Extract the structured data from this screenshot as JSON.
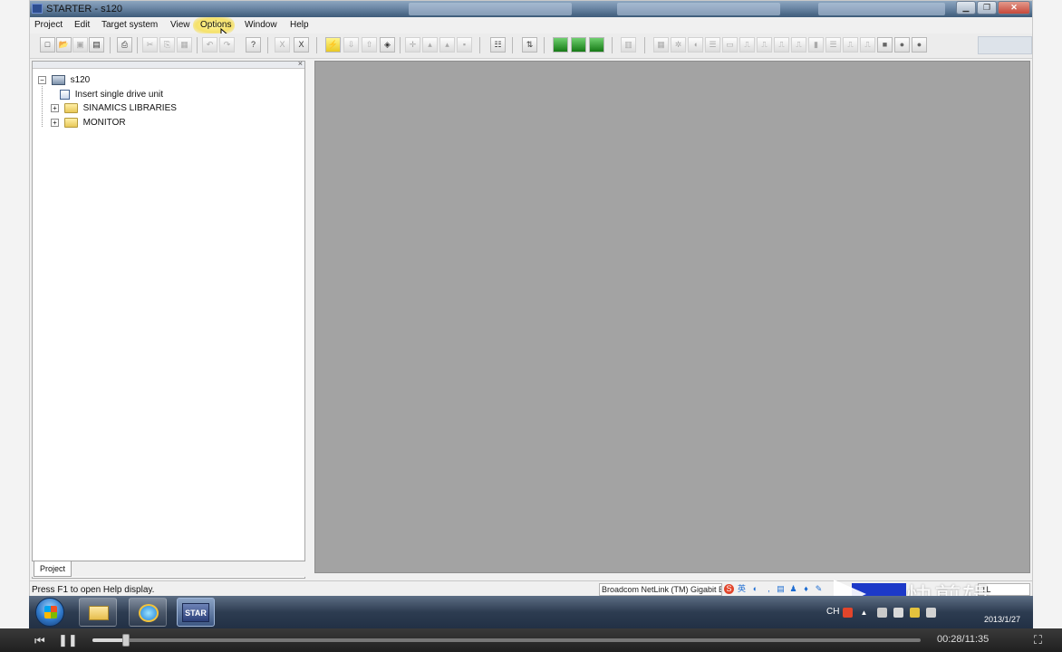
{
  "window": {
    "title": "STARTER - s120",
    "buttons": [
      "minimize",
      "maximize",
      "close"
    ]
  },
  "menubar": {
    "items": [
      "Project",
      "Edit",
      "Target system",
      "View",
      "Options",
      "Window",
      "Help"
    ],
    "highlighted": "Options"
  },
  "toolbar": {
    "groups": [
      [
        "new-icon",
        "open-icon",
        "save-icon",
        "save-compile-icon"
      ],
      [
        "print-icon"
      ],
      [
        "cut-icon",
        "copy-icon",
        "paste-icon"
      ],
      [
        "undo-icon",
        "redo-icon"
      ],
      [
        "help-pointer-icon"
      ],
      [
        "x-icon",
        "x-sub-icon"
      ],
      [
        "connect-icon",
        "download-icon",
        "upload-icon",
        "online-icon"
      ],
      [
        "move-icon",
        "load-device-icon",
        "load-cpu-icon",
        "load-ram-icon"
      ],
      [
        "device-table-icon"
      ],
      [
        "adjust-icon"
      ],
      [
        "panel-a-icon",
        "panel-b-icon",
        "panel-c-icon"
      ],
      [
        "print-preview-icon"
      ],
      [
        "tool1-icon",
        "tool2-icon",
        "tool3-icon",
        "tool4-icon",
        "tool5-icon",
        "tool6-icon",
        "tool7-icon",
        "tool8-icon",
        "tool9-icon",
        "tool10-icon",
        "tool11-icon",
        "tool12-icon",
        "tool13-icon",
        "stop-icon",
        "record-icon",
        "stop2-icon"
      ]
    ]
  },
  "project_tree": {
    "root": "s120",
    "items": [
      {
        "label": "Insert single drive unit",
        "icon": "insert-drive-icon",
        "expandable": false
      },
      {
        "label": "SINAMICS LIBRARIES",
        "icon": "folder-icon",
        "expandable": true
      },
      {
        "label": "MONITOR",
        "icon": "folder-icon",
        "expandable": true
      }
    ],
    "tab_label": "Project"
  },
  "statusbar": {
    "help_text": "Press F1 to open Help display.",
    "network": "Broadcom NetLink (TM) Gigabit Ethernet",
    "right_field": "TL"
  },
  "watermark": {
    "text": "快剪辑"
  },
  "taskbar": {
    "apps": [
      "explorer-icon",
      "ie-icon",
      "starter-icon"
    ],
    "active_app_label": "STAR",
    "tray_lang": "CH",
    "date": "2013/1/27"
  },
  "player": {
    "current": "00:28",
    "total": "11:35",
    "time_display": "00:28/11:35",
    "progress": 0.04
  }
}
